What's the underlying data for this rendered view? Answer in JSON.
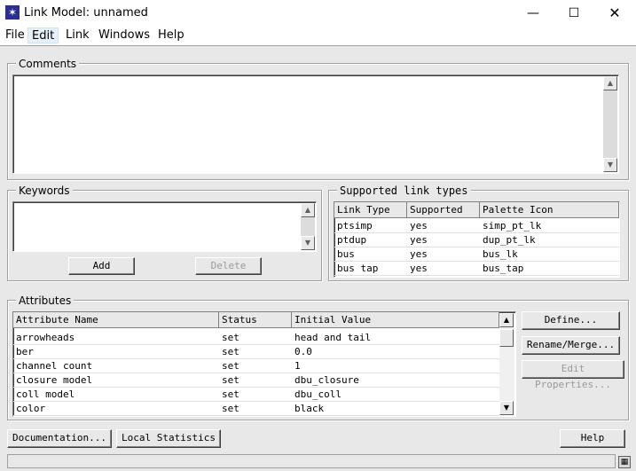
{
  "window": {
    "title": "Link Model: unnamed",
    "icon": "star-icon"
  },
  "menu": [
    "File",
    "Edit",
    "Link",
    "Windows",
    "Help"
  ],
  "comments": {
    "label": "Comments",
    "text": ""
  },
  "keywords": {
    "label": "Keywords",
    "add_label": "Add",
    "delete_label": "Delete"
  },
  "link_types": {
    "label": "Supported link types",
    "columns": [
      "Link Type",
      "Supported",
      "Palette Icon"
    ],
    "rows": [
      [
        "ptsimp",
        "yes",
        "simp_pt_lk"
      ],
      [
        "ptdup",
        "yes",
        "dup_pt_lk"
      ],
      [
        "bus",
        "yes",
        "bus_lk"
      ],
      [
        "bus tap",
        "yes",
        "bus_tap"
      ]
    ]
  },
  "attributes": {
    "label": "Attributes",
    "columns": [
      "Attribute Name",
      "Status",
      "Initial Value"
    ],
    "rows": [
      [
        "arrowheads",
        "set",
        "head and tail"
      ],
      [
        "ber",
        "set",
        "0.0"
      ],
      [
        "channel count",
        "set",
        "1"
      ],
      [
        "closure model",
        "set",
        "dbu_closure"
      ],
      [
        "coll model",
        "set",
        "dbu_coll"
      ],
      [
        "color",
        "set",
        "black"
      ]
    ],
    "define_label": "Define...",
    "rename_label": "Rename/Merge...",
    "edit_props_label": "Edit Properties..."
  },
  "footer": {
    "documentation": "Documentation...",
    "local_stats": "Local Statistics",
    "help": "Help"
  }
}
